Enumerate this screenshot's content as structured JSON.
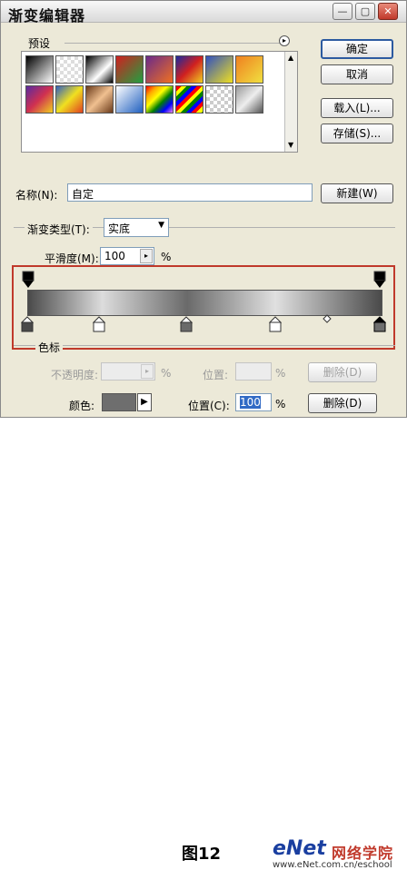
{
  "window": {
    "title": "渐变编辑器",
    "controls": [
      "minimize",
      "maximize",
      "close"
    ]
  },
  "presets": {
    "label": "预设",
    "swatches": [
      "linear-gradient(135deg,#000,#fff)",
      "repeating-conic-gradient(#ddd 0 25%, #fff 0 50%) 0 0/8px 8px",
      "linear-gradient(135deg,#000,#fff 60%,#000)",
      "linear-gradient(135deg,#d02020,#20a040)",
      "linear-gradient(135deg,#6a2a8a,#f07020)",
      "linear-gradient(135deg,#1a2aa0,#d02020,#f0d020)",
      "linear-gradient(135deg,#3050c0,#f0e020)",
      "linear-gradient(135deg,#f08020,#f0e040)",
      "linear-gradient(135deg,#5a2aa0,#d03050,#f0d020)",
      "linear-gradient(135deg,#3060c0,#f0e020,#e04020)",
      "linear-gradient(135deg,#6a3a1a,#f0c090,#6a3a1a)",
      "linear-gradient(135deg,#fff,#2060c0)",
      "linear-gradient(135deg,red,orange,yellow,green,blue,violet)",
      "repeating-linear-gradient(135deg,red 0 4px,yellow 4px 8px,green 8px 12px,blue 12px 16px)",
      "repeating-conic-gradient(#ccc 0 25%, #fff 0 50%) 0 0/8px 8px",
      "linear-gradient(135deg,#999,#eee,#555)"
    ]
  },
  "buttons": {
    "ok": "确定",
    "cancel": "取消",
    "load": "载入(L)...",
    "save": "存储(S)...",
    "new": "新建(W)"
  },
  "name": {
    "label": "名称(N):",
    "value": "自定"
  },
  "gradient_type": {
    "label": "渐变类型(T):",
    "value": "实底"
  },
  "smoothness": {
    "label": "平滑度(M):",
    "value": "100",
    "unit": "%"
  },
  "color_stops": {
    "label": "色标",
    "opacity_label": "不透明度:",
    "opacity_value": "",
    "opacity_unit": "%",
    "opacity_location_label": "位置:",
    "opacity_location_value": "",
    "opacity_location_unit": "%",
    "opacity_delete": "删除(D)",
    "color_label": "颜色:",
    "color_value": "#6e6e6e",
    "location_label": "位置(C):",
    "location_value": "100",
    "location_unit": "%",
    "delete": "删除(D)"
  },
  "caption": "图12",
  "watermark": {
    "brand": "eNet",
    "tagline": "网络学院",
    "url": "www.eNet.com.cn/eschool"
  }
}
